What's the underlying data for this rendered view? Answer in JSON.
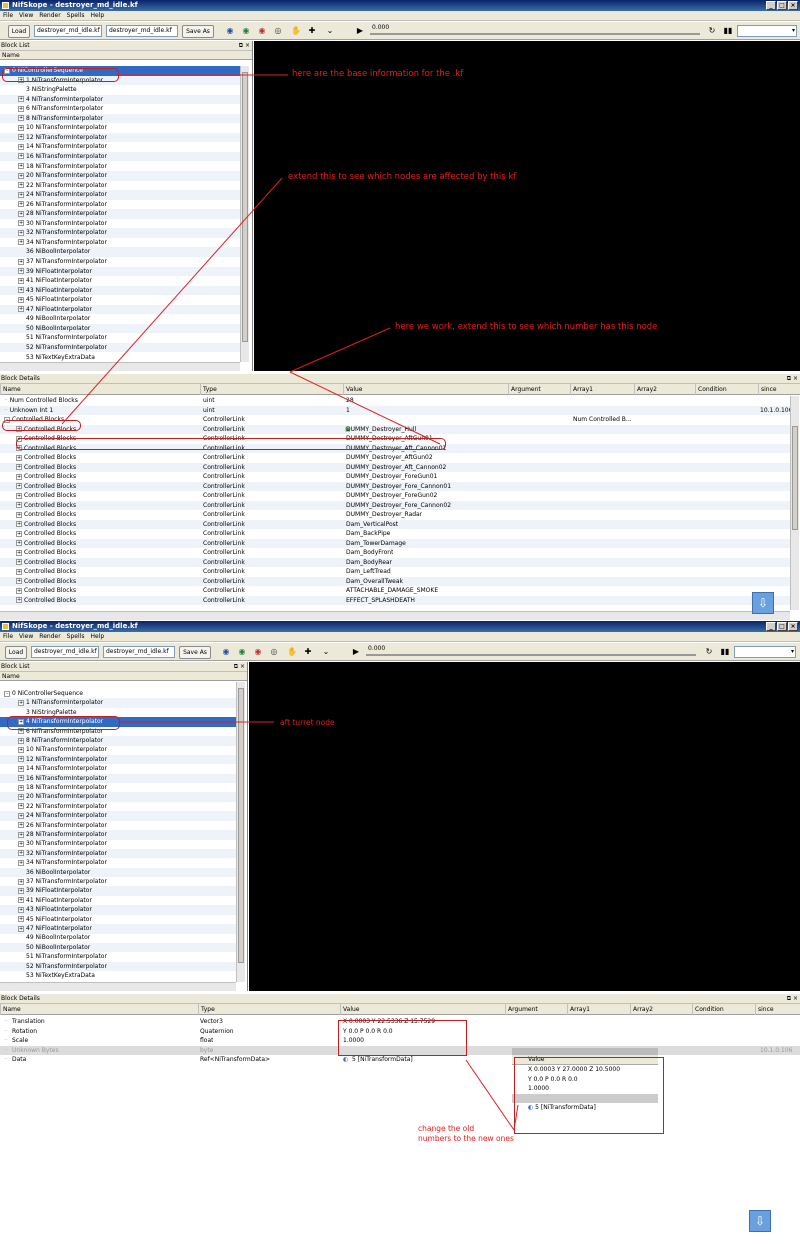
{
  "window_title": "NifSkope - destroyer_md_idle.kf",
  "menu": [
    "File",
    "View",
    "Render",
    "Spells",
    "Help"
  ],
  "toolbar": {
    "load": "Load",
    "file1": "destroyer_md_idle.kf",
    "file2": "destroyer_md_idle.kf",
    "save_as": "Save As",
    "time": "0.000"
  },
  "block_list_title": "Block List",
  "block_details_title": "Block Details",
  "name_col": "Name",
  "tree1": [
    {
      "t": "0  NiControllerSequence",
      "e": "-",
      "d": 0
    },
    {
      "t": "1  NiTransformInterpolator",
      "e": "+",
      "d": 1
    },
    {
      "t": "3  NiStringPalette",
      "e": "",
      "d": 1
    },
    {
      "t": "4  NiTransformInterpolator",
      "e": "+",
      "d": 1
    },
    {
      "t": "6  NiTransformInterpolator",
      "e": "+",
      "d": 1
    },
    {
      "t": "8  NiTransformInterpolator",
      "e": "+",
      "d": 1
    },
    {
      "t": "10  NiTransformInterpolator",
      "e": "+",
      "d": 1
    },
    {
      "t": "12  NiTransformInterpolator",
      "e": "+",
      "d": 1
    },
    {
      "t": "14  NiTransformInterpolator",
      "e": "+",
      "d": 1
    },
    {
      "t": "16  NiTransformInterpolator",
      "e": "+",
      "d": 1
    },
    {
      "t": "18  NiTransformInterpolator",
      "e": "+",
      "d": 1
    },
    {
      "t": "20  NiTransformInterpolator",
      "e": "+",
      "d": 1
    },
    {
      "t": "22  NiTransformInterpolator",
      "e": "+",
      "d": 1
    },
    {
      "t": "24  NiTransformInterpolator",
      "e": "+",
      "d": 1
    },
    {
      "t": "26  NiTransformInterpolator",
      "e": "+",
      "d": 1
    },
    {
      "t": "28  NiTransformInterpolator",
      "e": "+",
      "d": 1
    },
    {
      "t": "30  NiTransformInterpolator",
      "e": "+",
      "d": 1
    },
    {
      "t": "32  NiTransformInterpolator",
      "e": "+",
      "d": 1
    },
    {
      "t": "34  NiTransformInterpolator",
      "e": "+",
      "d": 1
    },
    {
      "t": "36  NiBoolInterpolator",
      "e": "",
      "d": 1
    },
    {
      "t": "37  NiTransformInterpolator",
      "e": "+",
      "d": 1
    },
    {
      "t": "39  NiFloatInterpolator",
      "e": "+",
      "d": 1
    },
    {
      "t": "41  NiFloatInterpolator",
      "e": "+",
      "d": 1
    },
    {
      "t": "43  NiFloatInterpolator",
      "e": "+",
      "d": 1
    },
    {
      "t": "45  NiFloatInterpolator",
      "e": "+",
      "d": 1
    },
    {
      "t": "47  NiFloatInterpolator",
      "e": "+",
      "d": 1
    },
    {
      "t": "49  NiBoolInterpolator",
      "e": "",
      "d": 1
    },
    {
      "t": "50  NiBoolInterpolator",
      "e": "",
      "d": 1
    },
    {
      "t": "51  NiTransformInterpolator",
      "e": "",
      "d": 1
    },
    {
      "t": "52  NiTransformInterpolator",
      "e": "",
      "d": 1
    },
    {
      "t": "53  NiTextKeyExtraData",
      "e": "",
      "d": 1
    }
  ],
  "details_cols": [
    "Name",
    "Type",
    "Value",
    "Argument",
    "Array1",
    "Array2",
    "Condition",
    "since"
  ],
  "details1": [
    {
      "n": "Num Controlled Blocks",
      "t": "uint",
      "v": "28",
      "a1": "",
      "s": "",
      "e": "",
      "d": 0
    },
    {
      "n": "Unknown Int 1",
      "t": "uint",
      "v": "1",
      "a1": "",
      "s": "10.1.0.106",
      "e": "",
      "d": 0
    },
    {
      "n": "Controlled Blocks",
      "t": "ControllerLink",
      "v": "",
      "a1": "Num Controlled B...",
      "s": "",
      "e": "-",
      "d": 0
    },
    {
      "n": "Controlled Blocks",
      "t": "ControllerLink",
      "v": "DUMMY_Destroyer_Hull",
      "a1": "",
      "s": "",
      "e": "+",
      "d": 1
    },
    {
      "n": "Controlled Blocks",
      "t": "ControllerLink",
      "v": "DUMMY_Destroyer_AftGun01",
      "a1": "",
      "s": "",
      "e": "+",
      "d": 1
    },
    {
      "n": "Controlled Blocks",
      "t": "ControllerLink",
      "v": "DUMMY_Destroyer_Aft_Cannon01",
      "a1": "",
      "s": "",
      "e": "+",
      "d": 1
    },
    {
      "n": "Controlled Blocks",
      "t": "ControllerLink",
      "v": "DUMMY_Destroyer_AftGun02",
      "a1": "",
      "s": "",
      "e": "+",
      "d": 1
    },
    {
      "n": "Controlled Blocks",
      "t": "ControllerLink",
      "v": "DUMMY_Destroyer_Aft_Cannon02",
      "a1": "",
      "s": "",
      "e": "+",
      "d": 1
    },
    {
      "n": "Controlled Blocks",
      "t": "ControllerLink",
      "v": "DUMMY_Destroyer_ForeGun01",
      "a1": "",
      "s": "",
      "e": "+",
      "d": 1
    },
    {
      "n": "Controlled Blocks",
      "t": "ControllerLink",
      "v": "DUMMY_Destroyer_Fore_Cannon01",
      "a1": "",
      "s": "",
      "e": "+",
      "d": 1
    },
    {
      "n": "Controlled Blocks",
      "t": "ControllerLink",
      "v": "DUMMY_Destroyer_ForeGun02",
      "a1": "",
      "s": "",
      "e": "+",
      "d": 1
    },
    {
      "n": "Controlled Blocks",
      "t": "ControllerLink",
      "v": "DUMMY_Destroyer_Fore_Cannon02",
      "a1": "",
      "s": "",
      "e": "+",
      "d": 1
    },
    {
      "n": "Controlled Blocks",
      "t": "ControllerLink",
      "v": "DUMMY_Destroyer_Radar",
      "a1": "",
      "s": "",
      "e": "+",
      "d": 1
    },
    {
      "n": "Controlled Blocks",
      "t": "ControllerLink",
      "v": "Dam_VerticalPost",
      "a1": "",
      "s": "",
      "e": "+",
      "d": 1
    },
    {
      "n": "Controlled Blocks",
      "t": "ControllerLink",
      "v": "Dam_BackPipe",
      "a1": "",
      "s": "",
      "e": "+",
      "d": 1
    },
    {
      "n": "Controlled Blocks",
      "t": "ControllerLink",
      "v": "Dam_TowerDamage",
      "a1": "",
      "s": "",
      "e": "+",
      "d": 1
    },
    {
      "n": "Controlled Blocks",
      "t": "ControllerLink",
      "v": "Dam_BodyFront",
      "a1": "",
      "s": "",
      "e": "+",
      "d": 1
    },
    {
      "n": "Controlled Blocks",
      "t": "ControllerLink",
      "v": "Dam_BodyRear",
      "a1": "",
      "s": "",
      "e": "+",
      "d": 1
    },
    {
      "n": "Controlled Blocks",
      "t": "ControllerLink",
      "v": "Dam_LeftTread",
      "a1": "",
      "s": "",
      "e": "+",
      "d": 1
    },
    {
      "n": "Controlled Blocks",
      "t": "ControllerLink",
      "v": "Dam_OverallTweak",
      "a1": "",
      "s": "",
      "e": "+",
      "d": 1
    },
    {
      "n": "Controlled Blocks",
      "t": "ControllerLink",
      "v": "ATTACHABLE_DAMAGE_SMOKE",
      "a1": "",
      "s": "",
      "e": "+",
      "d": 1
    },
    {
      "n": "Controlled Blocks",
      "t": "ControllerLink",
      "v": "EFFECT_SPLASHDEATH",
      "a1": "",
      "s": "",
      "e": "+",
      "d": 1
    }
  ],
  "details2": [
    {
      "n": "Translation",
      "t": "Vector3",
      "v": "X 0.0003 Y 22.5336 Z 15.7529",
      "s": "",
      "g": false
    },
    {
      "n": "Rotation",
      "t": "Quaternion",
      "v": "Y 0.0 P 0.0 R 0.0",
      "s": "",
      "g": false
    },
    {
      "n": "Scale",
      "t": "float",
      "v": "1.0000",
      "s": "",
      "g": false
    },
    {
      "n": "Unknown Bytes",
      "t": "byte",
      "v": "",
      "s": "10.1.0.106",
      "g": true
    },
    {
      "n": "Data",
      "t": "Ref<NiTransformData>",
      "v": "5 [NiTransformData]",
      "s": "",
      "g": false
    }
  ],
  "popup": {
    "header": "Value",
    "rows": [
      "X 0.0003 Y 27.0000 Z 10.5000",
      "Y 0.0 P 0.0 R 0.0",
      "1.0000",
      "",
      "5 [NiTransformData]"
    ]
  },
  "annotations": {
    "a1": "here are the base information for the .kf",
    "a2": "extend this to see which nodes are affected by this kf",
    "a3": "here we work, extend this to see which number has this node",
    "a4": "aft turret node",
    "a5": "change the old\nnumbers to the new ones"
  },
  "colors": {
    "accent": "#e02020",
    "selection": "#316ac5"
  }
}
